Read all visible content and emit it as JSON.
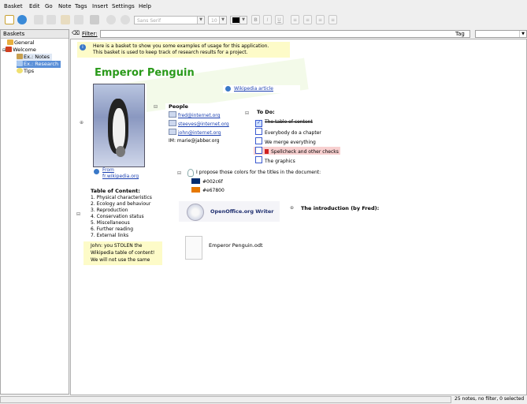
{
  "menu": [
    "Basket",
    "Edit",
    "Go",
    "Note",
    "Tags",
    "Insert",
    "Settings",
    "Help"
  ],
  "toolbar": {
    "font_name": "Sans Serif",
    "font_size": "10",
    "bold": "B",
    "italic": "I",
    "underline": "U"
  },
  "sidebar": {
    "header": "Baskets",
    "items": [
      {
        "label": "General"
      },
      {
        "label": "Welcome"
      },
      {
        "label": "Ex.: Notes"
      },
      {
        "label": "Ex.: Research"
      },
      {
        "label": "Tips"
      }
    ]
  },
  "filterbar": {
    "filter_label": "Filter:",
    "tag_label": "Tag"
  },
  "basket": {
    "intro_line1": "Here is a basket to show you some examples of usage for this application.",
    "intro_line2": "This basket is used to keep track of research results for a project.",
    "title": "Emperor Penguin",
    "wiki_link": "Wikipedia article",
    "image_caption_from": "From",
    "image_caption_site": "fr.wikipedia.org",
    "people": {
      "header": "People",
      "items": [
        "fred@internet.org",
        "steeves@internet.org",
        "john@internet.org"
      ],
      "im": "IM: marie@jabber.org"
    },
    "todo": {
      "header": "To Do:",
      "items": [
        {
          "text": "The table of content",
          "done": true
        },
        {
          "text": "Everybody do a chapter",
          "done": false
        },
        {
          "text": "We merge everything",
          "done": false
        },
        {
          "text": "Spellcheck and other checks",
          "done": false,
          "important": true
        },
        {
          "text": "The graphics",
          "done": false
        }
      ]
    },
    "colors": {
      "intro": "I propose those colors for the titles in the document:",
      "items": [
        {
          "hex": "#002c6f",
          "label": "#002c6f"
        },
        {
          "hex": "#e67800",
          "label": "#e67800"
        }
      ]
    },
    "toc": {
      "header": "Table of Content:",
      "items": [
        "1. Physical characteristics",
        "2. Ecology and behaviour",
        "3. Reproduction",
        "4. Conservation status",
        "5. Miscellaneous",
        "6. Further reading",
        "7. External links"
      ],
      "comment_line1": "John: you STOLEN the",
      "comment_line2": "Wikipedia table of content!",
      "comment_line3": "We will not use the same"
    },
    "writer_launcher": "OpenOffice.org Writer",
    "intro_by_fred": "The introduction (by Fred):",
    "file_note": "Emperor Penguin.odt"
  },
  "statusbar": {
    "text": "25 notes, no filter, 0 selected"
  },
  "colors": {
    "accent": "#4a8bd6",
    "title_green": "#2a9a1a",
    "yellow_note": "#fdfbc8",
    "important_bg": "#f8d0d0"
  }
}
